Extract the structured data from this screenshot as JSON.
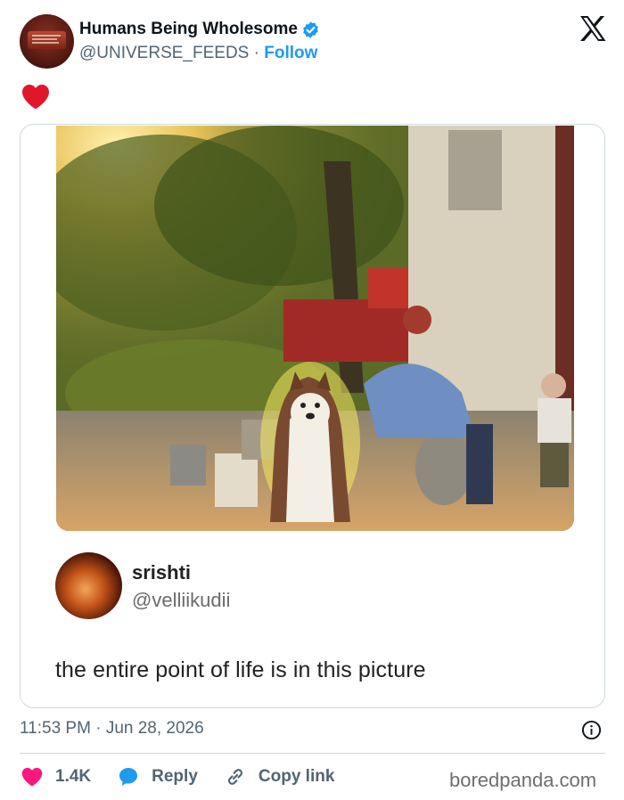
{
  "header": {
    "display_name": "Humans Being Wholesome",
    "handle": "@UNIVERSE_FEEDS",
    "separator": "·",
    "follow_label": "Follow"
  },
  "quoted_post": {
    "display_name": "srishti",
    "handle": "@velliikudii",
    "text": "the entire point of life is in this picture"
  },
  "meta": {
    "time": "11:53 PM",
    "separator": "·",
    "date": "Jun 28, 2026"
  },
  "actions": {
    "like_count": "1.4K",
    "reply_label": "Reply",
    "copy_link_label": "Copy link"
  },
  "watermark": "boredpanda.com",
  "colors": {
    "accent": "#1d9bf0",
    "like": "#f91880",
    "text_secondary": "#536471",
    "border": "#cfd9de"
  },
  "icons": {
    "verified": "verified-badge-icon",
    "platform": "x-logo-icon",
    "reaction": "heart-icon",
    "info": "info-icon",
    "reply": "speech-bubble-icon",
    "copy": "link-icon"
  }
}
